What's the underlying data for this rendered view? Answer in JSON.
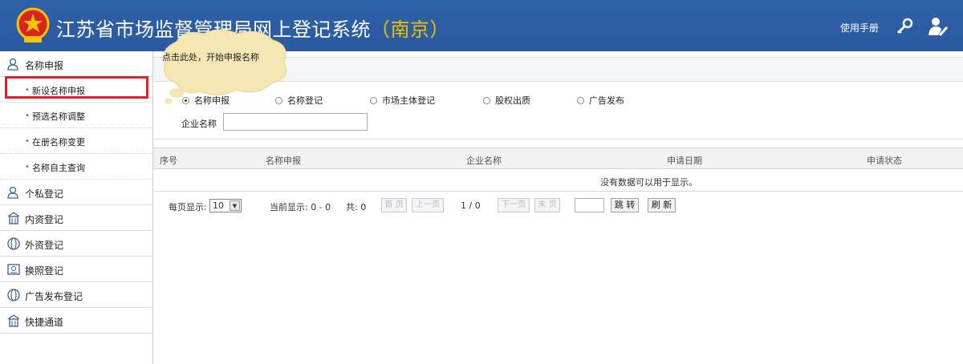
{
  "header": {
    "title": "江苏省市场监督管理局网上登记系统",
    "city": "（南京）",
    "manual_label": "使用手册",
    "icons": [
      "emblem-icon",
      "key-icon",
      "user-edit-icon"
    ]
  },
  "tooltip": {
    "text": "点击此处，开始申报名称"
  },
  "sidebar": {
    "groups": [
      {
        "label": "名称申报",
        "icon": "person-icon"
      },
      {
        "label": "个私登记",
        "icon": "person-icon"
      },
      {
        "label": "内资登记",
        "icon": "building-icon"
      },
      {
        "label": "外资登记",
        "icon": "globe-icon"
      },
      {
        "label": "换照登记",
        "icon": "license-icon"
      },
      {
        "label": "广告发布登记",
        "icon": "globe-icon"
      },
      {
        "label": "快捷通道",
        "icon": "building-icon"
      }
    ],
    "sub_items": [
      "新设名称申报",
      "预选名称调整",
      "在册名称变更",
      "名称自主查询"
    ]
  },
  "filter": {
    "radios": [
      {
        "label": "名称申报",
        "checked": true
      },
      {
        "label": "名称登记",
        "checked": false
      },
      {
        "label": "市场主体登记",
        "checked": false
      },
      {
        "label": "股权出质",
        "checked": false
      },
      {
        "label": "广告发布",
        "checked": false
      }
    ],
    "company_label": "企业名称",
    "company_value": ""
  },
  "table": {
    "columns": [
      "序号",
      "名称申报",
      "企业名称",
      "申请日期",
      "申请状态"
    ],
    "empty_message": "没有数据可以用于显示。"
  },
  "pager": {
    "page_size_label": "每页显示:",
    "page_size": "10",
    "current_label": "当前显示: 0 - 0",
    "total_label": "共: 0",
    "first": "首 页",
    "prev": "上一页",
    "page_info": "1 / 0",
    "next": "下一页",
    "last": "末 页",
    "goto": "跳 转",
    "refresh": "刷 新"
  },
  "colors": {
    "header_bg": "#2c5da5",
    "city": "#f3c000",
    "highlight": "#e21f26",
    "tooltip_cloud": "#f4e7b3"
  }
}
